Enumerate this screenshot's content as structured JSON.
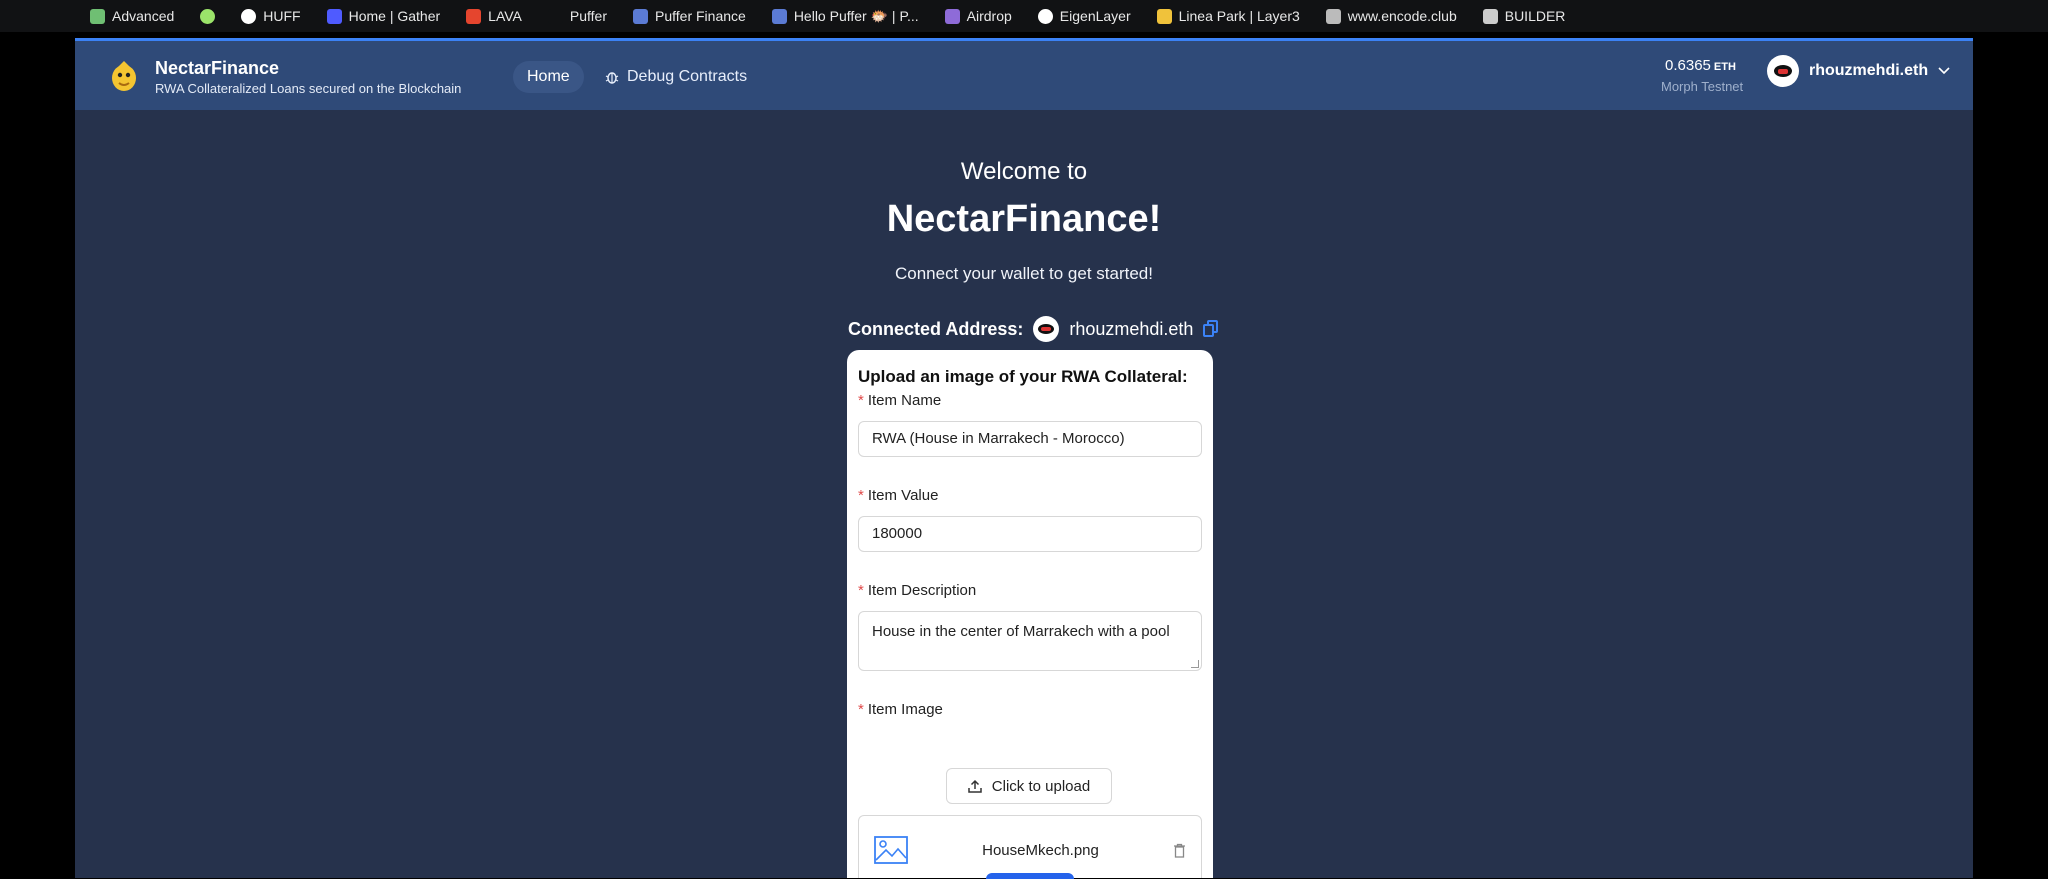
{
  "bookmarks": [
    {
      "label": "Advanced",
      "icon": "stack-icon",
      "color": "#6fbf73"
    },
    {
      "label": "",
      "icon": "lime-circle-icon",
      "color": "#9be36a"
    },
    {
      "label": "HUFF",
      "icon": "globe-icon",
      "color": "#ffffff"
    },
    {
      "label": "Home | Gather",
      "icon": "gather-icon",
      "color": "#4f5bff"
    },
    {
      "label": "LAVA",
      "icon": "lava-icon",
      "color": "#e5452e"
    },
    {
      "label": "Puffer",
      "icon": "puffer-icon",
      "color": "#111214"
    },
    {
      "label": "Puffer Finance",
      "icon": "puffer-finance-icon",
      "color": "#5b7bd5"
    },
    {
      "label": "Hello Puffer 🐡 | P...",
      "icon": "puffer-finance-icon",
      "color": "#5b7bd5"
    },
    {
      "label": "Airdrop",
      "icon": "layers-icon",
      "color": "#8e6bd8"
    },
    {
      "label": "EigenLayer",
      "icon": "globe-icon",
      "color": "#ffffff"
    },
    {
      "label": "Linea Park | Layer3",
      "icon": "smiley-icon",
      "color": "#f0c23b"
    },
    {
      "label": "www.encode.club",
      "icon": "encode-icon",
      "color": "#bbbbbb"
    },
    {
      "label": "BUILDER",
      "icon": "castle-icon",
      "color": "#cccccc"
    }
  ],
  "header": {
    "brand_title": "NectarFinance",
    "brand_subtitle": "RWA Collateralized Loans secured on the Blockchain",
    "nav_home": "Home",
    "nav_debug": "Debug Contracts",
    "balance": "0.6365",
    "balance_unit": "ETH",
    "network": "Morph Testnet",
    "account": "rhouzmehdi.eth"
  },
  "hero": {
    "welcome": "Welcome to",
    "title": "NectarFinance!",
    "subtitle": "Connect your wallet to get started!",
    "connected_label": "Connected Address:",
    "connected_address": "rhouzmehdi.eth"
  },
  "form": {
    "heading": "Upload an image of your RWA Collateral:",
    "required_mark": "*",
    "item_name_label": "Item Name",
    "item_name_value": "RWA (House in Marrakech - Morocco)",
    "item_value_label": "Item Value",
    "item_value_value": "180000",
    "item_desc_label": "Item Description",
    "item_desc_value": "House in the center of Marrakech with a pool",
    "item_image_label": "Item Image",
    "upload_label": "Click to upload",
    "file_name": "HouseMkech.png"
  }
}
